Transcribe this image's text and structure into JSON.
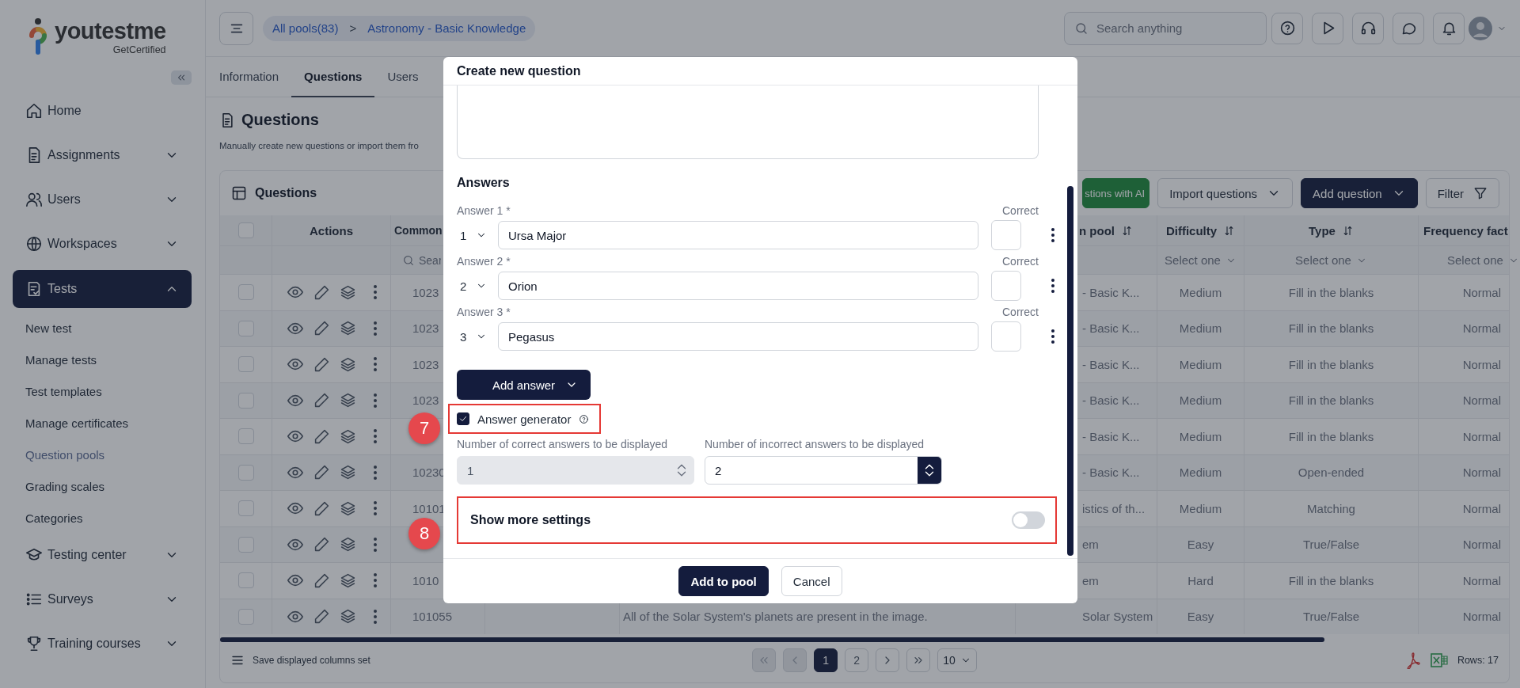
{
  "sidebar": {
    "logo": {
      "text": "youtestme",
      "tagline": "GetCertified"
    },
    "items": [
      {
        "label": "Home",
        "kind": "link",
        "selected": false
      },
      {
        "label": "Assignments",
        "kind": "group",
        "expanded": false,
        "selected": false
      },
      {
        "label": "Users",
        "kind": "group",
        "expanded": false,
        "selected": false
      },
      {
        "label": "Workspaces",
        "kind": "group",
        "expanded": false,
        "selected": false
      },
      {
        "label": "Tests",
        "kind": "group",
        "expanded": true,
        "selected": true,
        "children": [
          {
            "label": "New test",
            "selected": false
          },
          {
            "label": "Manage tests",
            "selected": false
          },
          {
            "label": "Test templates",
            "selected": false
          },
          {
            "label": "Manage certificates",
            "selected": false
          },
          {
            "label": "Question pools",
            "selected": true
          },
          {
            "label": "Grading scales",
            "selected": false
          },
          {
            "label": "Categories",
            "selected": false
          }
        ]
      },
      {
        "label": "Testing center",
        "kind": "group",
        "expanded": false,
        "selected": false
      },
      {
        "label": "Surveys",
        "kind": "group",
        "expanded": false,
        "selected": false
      },
      {
        "label": "Training courses",
        "kind": "group",
        "expanded": false,
        "selected": false
      }
    ]
  },
  "header": {
    "breadcrumb": [
      {
        "label": "All pools(83)"
      },
      {
        "label": "Astronomy - Basic Knowledge"
      }
    ],
    "separator": ">",
    "search": {
      "placeholder": "Search anything"
    }
  },
  "tabs": [
    {
      "label": "Information",
      "selected": false
    },
    {
      "label": "Questions",
      "selected": true
    },
    {
      "label": "Users",
      "selected": false
    }
  ],
  "page": {
    "title": "Questions",
    "subtitle": "Manually create new questions or import them fro"
  },
  "table": {
    "title": "Questions",
    "toolbar": [
      {
        "label": "stions with AI",
        "kind": "ai"
      },
      {
        "label": "Import questions",
        "kind": "dropdown"
      },
      {
        "label": "Add question",
        "kind": "primary"
      },
      {
        "label": "Filter",
        "kind": "filter"
      }
    ],
    "select_all": {
      "checked": false
    },
    "columns": [
      {
        "label": "Actions",
        "sortable": false
      },
      {
        "label": "Common",
        "sortable": false,
        "filter": {
          "kind": "search",
          "placeholder": "Sear"
        }
      },
      {
        "label": "n pool",
        "sortable": true
      },
      {
        "label": "Difficulty",
        "sortable": true,
        "filter": {
          "kind": "select",
          "label": "Select one"
        }
      },
      {
        "label": "Type",
        "sortable": true,
        "filter": {
          "kind": "select",
          "label": "Select one"
        }
      },
      {
        "label": "Frequency fact",
        "sortable": false,
        "filter": {
          "kind": "select",
          "label": "Select one"
        }
      }
    ],
    "rows": [
      {
        "checked": false,
        "id": "1023",
        "pool": "- Basic K...",
        "difficulty": "Medium",
        "type": "Fill in the blanks",
        "frequency": "Normal"
      },
      {
        "checked": false,
        "id": "1023",
        "pool": "- Basic K...",
        "difficulty": "Medium",
        "type": "Fill in the blanks",
        "frequency": "Normal"
      },
      {
        "checked": false,
        "id": "1023",
        "pool": "- Basic K...",
        "difficulty": "Medium",
        "type": "Fill in the blanks",
        "frequency": "Normal"
      },
      {
        "checked": false,
        "id": "1023",
        "pool": "- Basic K...",
        "difficulty": "Medium",
        "type": "Fill in the blanks",
        "frequency": "Normal"
      },
      {
        "checked": false,
        "pool": "- Basic K...",
        "difficulty": "Medium",
        "type": "Fill in the blanks",
        "frequency": "Normal"
      },
      {
        "checked": false,
        "id": "10230",
        "pool": "- Basic K...",
        "difficulty": "Medium",
        "type": "Open-ended",
        "frequency": "Normal"
      },
      {
        "checked": false,
        "id": "10101",
        "pool": "istics of th...",
        "difficulty": "Medium",
        "type": "Matching",
        "frequency": "Normal"
      },
      {
        "checked": false,
        "pool": "em",
        "difficulty": "Easy",
        "type": "True/False",
        "frequency": "Normal"
      },
      {
        "checked": false,
        "id": "1010",
        "pool": "em",
        "difficulty": "Hard",
        "type": "Fill in the blanks",
        "frequency": "Normal"
      },
      {
        "checked": false,
        "id": "101055",
        "question": "All of the Solar System's planets are present in the image.",
        "pool": "Solar System",
        "difficulty": "Easy",
        "type": "True/False",
        "frequency": "Normal"
      }
    ],
    "footer": {
      "save": "Save displayed columns set",
      "pagination": [
        {
          "kind": "first",
          "disabled": true
        },
        {
          "kind": "prev",
          "disabled": true
        },
        {
          "kind": "page",
          "label": "1",
          "selected": true
        },
        {
          "kind": "page",
          "label": "2",
          "selected": false
        },
        {
          "kind": "next",
          "disabled": false
        },
        {
          "kind": "last",
          "disabled": false
        }
      ],
      "page_size": "10",
      "rows": "Rows: 17"
    }
  },
  "modal": {
    "title": "Create new question",
    "answers_heading": "Answers",
    "answers": [
      {
        "label": "Answer 1 *",
        "order": "1",
        "value": "Ursa Major",
        "correct_label": "Correct",
        "correct": false
      },
      {
        "label": "Answer 2 *",
        "order": "2",
        "value": "Orion",
        "correct_label": "Correct",
        "correct": false
      },
      {
        "label": "Answer 3 *",
        "order": "3",
        "value": "Pegasus",
        "correct_label": "Correct",
        "correct": false
      }
    ],
    "add_answer": "Add answer",
    "generator": {
      "label": "Answer generator",
      "checked": true,
      "highlighted": true
    },
    "counts": [
      {
        "label": "Number of correct answers to be displayed",
        "value": "1",
        "disabled": true
      },
      {
        "label": "Number of incorrect answers to be displayed",
        "value": "2",
        "disabled": false
      }
    ],
    "more_settings": {
      "label": "Show more settings",
      "on": false,
      "highlighted": true
    },
    "buttons": [
      {
        "label": "Add to pool",
        "kind": "primary"
      },
      {
        "label": "Cancel",
        "kind": "secondary"
      }
    ]
  },
  "annotations": [
    {
      "label": "7"
    },
    {
      "label": "8"
    }
  ]
}
